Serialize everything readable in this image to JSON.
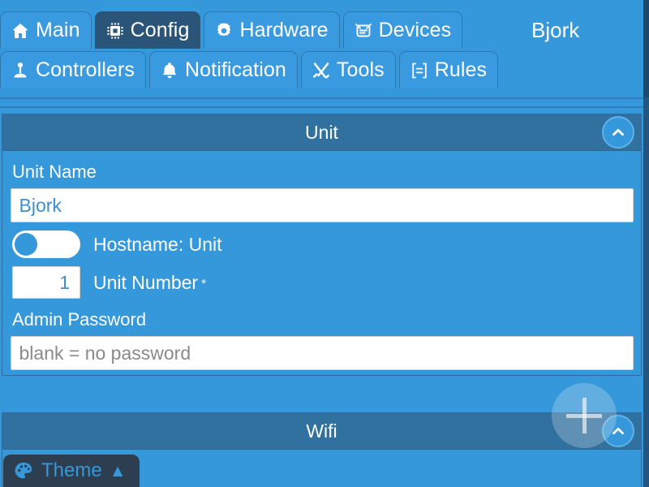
{
  "header": {
    "unit_title": "Bjork",
    "tabs_row1": [
      {
        "label": "Main",
        "icon": "home-icon",
        "active": false
      },
      {
        "label": "Config",
        "icon": "chip-icon",
        "active": true
      },
      {
        "label": "Hardware",
        "icon": "gear-icon",
        "active": false
      },
      {
        "label": "Devices",
        "icon": "devices-icon",
        "active": false
      }
    ],
    "tabs_row2": [
      {
        "label": "Controllers",
        "icon": "joystick-icon",
        "active": false
      },
      {
        "label": "Notification",
        "icon": "bell-icon",
        "active": false
      },
      {
        "label": "Tools",
        "icon": "tools-icon",
        "active": false
      },
      {
        "label": "Rules",
        "icon": "rules-icon",
        "active": false
      }
    ]
  },
  "unit_panel": {
    "title": "Unit",
    "collapse_icon": "chevron-up-icon",
    "unit_name_label": "Unit Name",
    "unit_name_value": "Bjork",
    "unit_name_placeholder": "",
    "hostname_toggle_label": "Hostname: Unit",
    "hostname_toggle_state": "off",
    "unit_number_value": "1",
    "unit_number_label": "Unit Number",
    "unit_number_required_mark": "*",
    "admin_password_label": "Admin Password",
    "admin_password_value": "",
    "admin_password_placeholder": "blank = no password"
  },
  "wifi_panel": {
    "title": "Wifi",
    "collapse_icon": "chevron-up-icon"
  },
  "fab": {
    "name": "add-button",
    "icon": "plus-icon"
  },
  "theme_button": {
    "label": "Theme",
    "icon": "palette-icon",
    "caret": "▲"
  },
  "colors": {
    "background_blue": "#3498db",
    "panel_header_blue": "#30719f",
    "active_tab_navy": "#2a5579",
    "tab_blue": "#3a9ae0",
    "page_edge": "#23557e",
    "theme_bg": "#2d3e50",
    "input_text_blue": "#3d8fd1",
    "placeholder_gray": "#8a8a8a"
  }
}
